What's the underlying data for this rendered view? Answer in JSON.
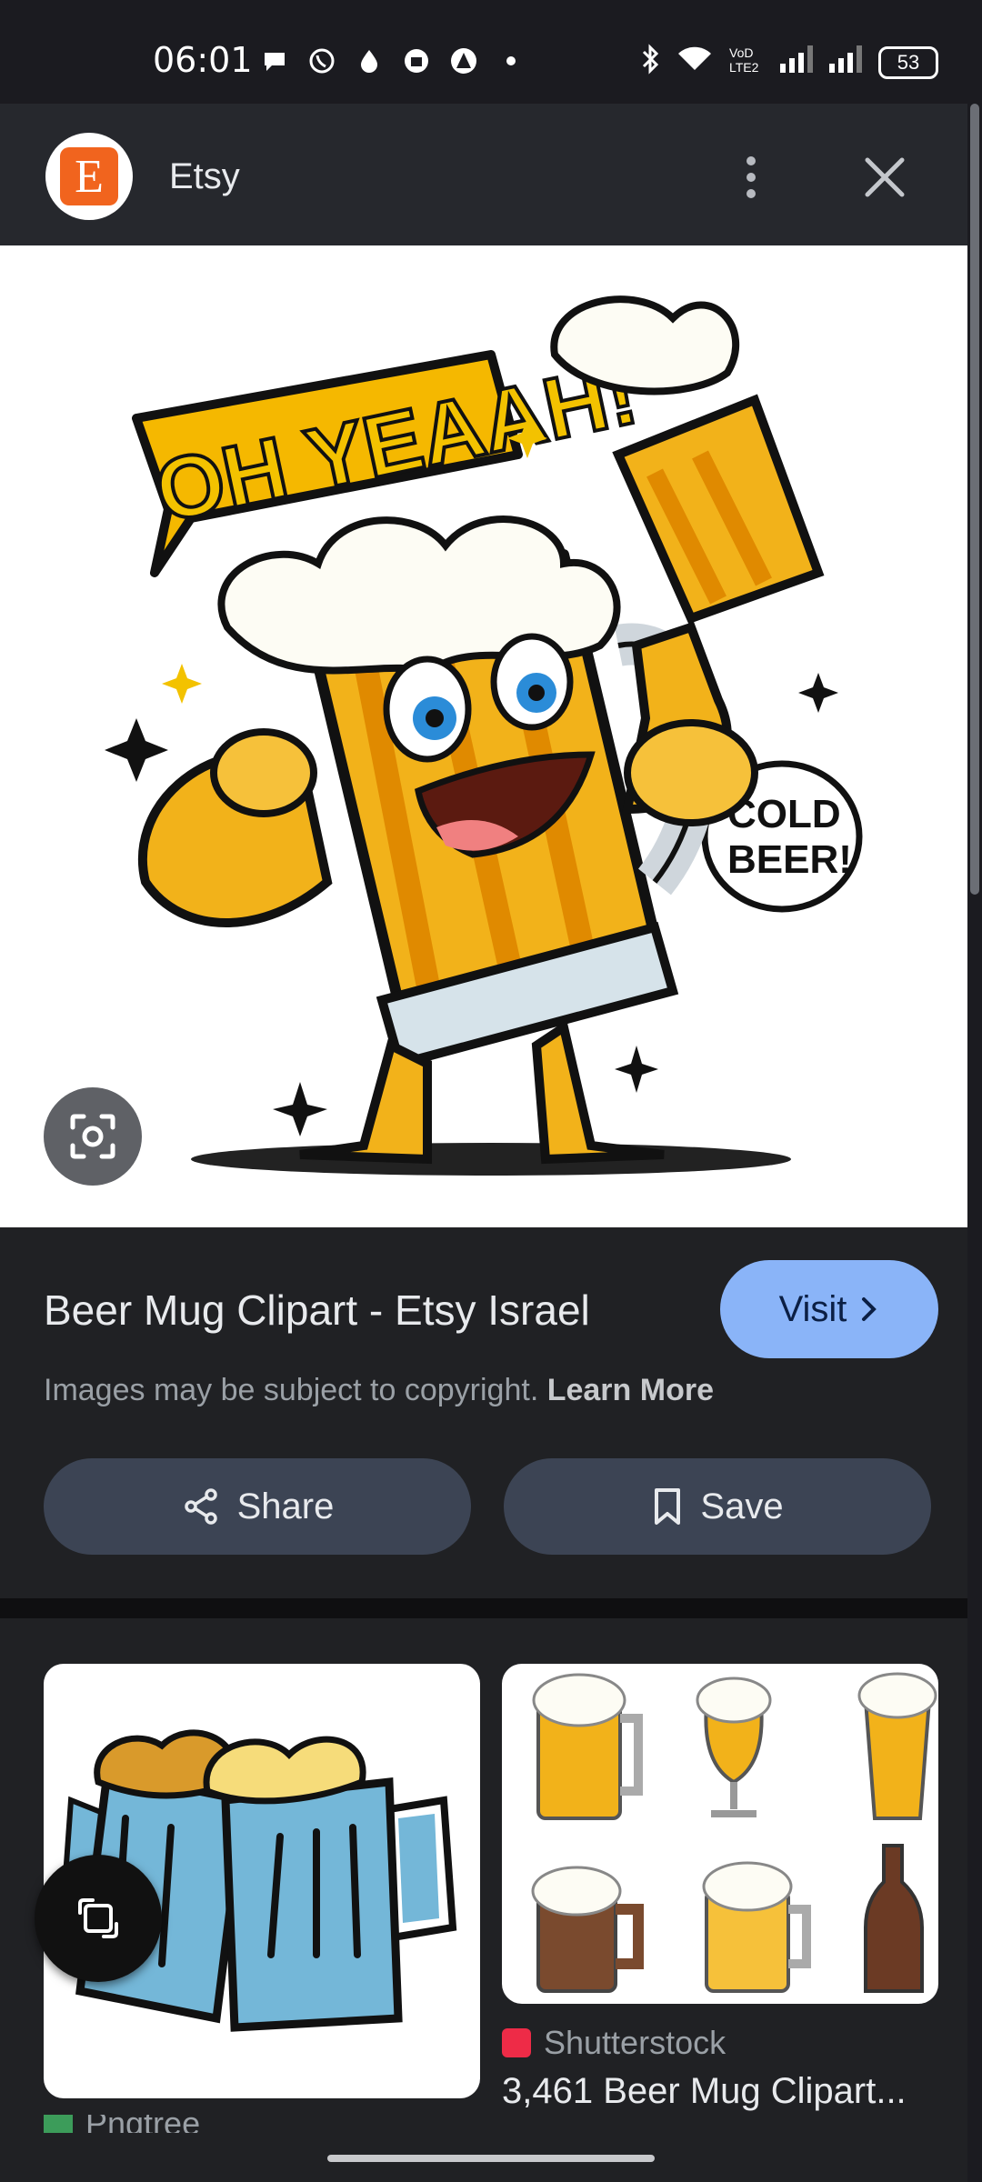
{
  "status_bar": {
    "time": "06:01",
    "battery": "53",
    "icons_left": [
      "chat-bubble-icon",
      "whatsapp-icon",
      "drop-icon",
      "shopping-bag-icon",
      "triangle-app-icon",
      "dot-icon"
    ],
    "icons_right": [
      "bluetooth-icon",
      "wifi-icon",
      "volte-icon",
      "signal-icon",
      "signal-icon",
      "battery-icon"
    ]
  },
  "app_bar": {
    "title": "Etsy",
    "logo_letter": "E",
    "more_icon": "more-vertical-icon",
    "close_icon": "close-icon"
  },
  "hero_image": {
    "speech_left": "OH YEAAH!",
    "speech_right_line1": "COLD",
    "speech_right_line2": "BEER!"
  },
  "result": {
    "title": "Beer Mug Clipart - Etsy Israel",
    "visit_label": "Visit",
    "copyright_text": "Images may be subject to copyright.",
    "learn_more": "Learn More",
    "share_label": "Share",
    "save_label": "Save"
  },
  "related": [
    {
      "source": "Pngtree",
      "caption": ""
    },
    {
      "source": "Shutterstock",
      "caption": "3,461 Beer Mug Clipart..."
    }
  ],
  "colors": {
    "accent": "#8ab4f8",
    "etsy_orange": "#f1641e",
    "pill_bg": "#3c4454",
    "shutterstock_red": "#ee2b47"
  }
}
